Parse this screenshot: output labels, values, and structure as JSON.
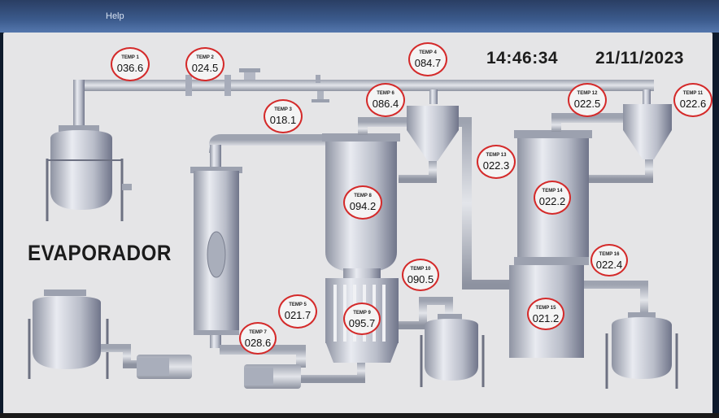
{
  "window": {
    "menu": {
      "help_label": "Help"
    }
  },
  "header": {
    "time": "14:46:34",
    "date": "21/11/2023"
  },
  "title": "EVAPORADOR",
  "colors": {
    "tag_border": "#d42a2a",
    "pipe": "#c3c7d0",
    "vessel": "#bfc3cf"
  },
  "temps": [
    {
      "label": "TEMP 1",
      "value": "036.6"
    },
    {
      "label": "TEMP 2",
      "value": "024.5"
    },
    {
      "label": "TEMP 3",
      "value": "018.1"
    },
    {
      "label": "TEMP 4",
      "value": "084.7"
    },
    {
      "label": "TEMP 5",
      "value": "021.7"
    },
    {
      "label": "TEMP 6",
      "value": "086.4"
    },
    {
      "label": "TEMP 7",
      "value": "028.6"
    },
    {
      "label": "TEMP 8",
      "value": "094.2"
    },
    {
      "label": "TEMP 9",
      "value": "095.7"
    },
    {
      "label": "TEMP 10",
      "value": "090.5"
    },
    {
      "label": "TEMP 11",
      "value": "022.6"
    },
    {
      "label": "TEMP 12",
      "value": "022.5"
    },
    {
      "label": "TEMP 13",
      "value": "022.3"
    },
    {
      "label": "TEMP 14",
      "value": "022.2"
    },
    {
      "label": "TEMP 15",
      "value": "021.2"
    },
    {
      "label": "TEMP 16",
      "value": "022.4"
    }
  ]
}
